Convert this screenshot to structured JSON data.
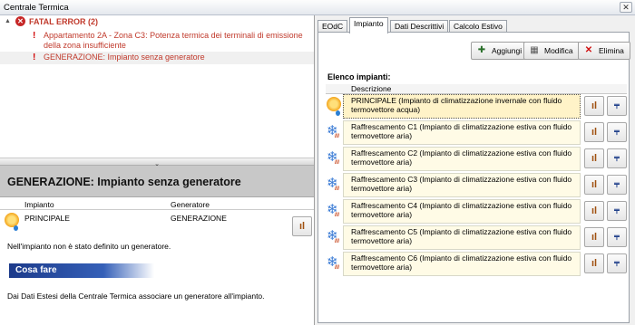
{
  "window": {
    "title": "Centrale Termica",
    "close_label": "✕"
  },
  "tree": {
    "collapse_glyph": "▲",
    "fatal_label": "FATAL ERROR (2)",
    "items": [
      {
        "text": "Appartamento 2A - Zona C3: Potenza termica dei terminali di emissione della zona insufficiente"
      },
      {
        "text": "GENERAZIONE: Impianto senza generatore"
      }
    ],
    "warn_glyph": "!"
  },
  "splitter_glyph": "⌄",
  "detail": {
    "title": "GENERAZIONE: Impianto senza generatore",
    "columns": [
      "Impianto",
      "Generatore"
    ],
    "row": {
      "impianto": "PRINCIPALE",
      "generatore": "GENERAZIONE"
    },
    "message": "Nell'impianto non è stato definito un generatore.",
    "todo_title": "Cosa fare",
    "hint": "Dai Dati Estesi della Centrale Termica associare un generatore all'impianto."
  },
  "tabs": [
    "EOdC",
    "Impianto",
    "Dati Descrittivi",
    "Calcolo Estivo"
  ],
  "active_tab": "Impianto",
  "toolbar": {
    "add_label": "Aggiungi",
    "edit_label": "Modifica",
    "delete_label": "Elimina"
  },
  "list": {
    "title": "Elenco impianti:",
    "column": "Descrizione",
    "rows": [
      {
        "text": "PRINCIPALE (Impianto di climatizzazione invernale con fluido termovettore acqua)",
        "icon": "sun-icon"
      },
      {
        "text": "Raffrescamento C1 (Impianto di climatizzazione estiva con fluido termovettore aria)",
        "icon": "snowflake-icon"
      },
      {
        "text": "Raffrescamento C2 (Impianto di climatizzazione estiva con fluido termovettore aria)",
        "icon": "snowflake-icon"
      },
      {
        "text": "Raffrescamento C3 (Impianto di climatizzazione estiva con fluido termovettore aria)",
        "icon": "snowflake-icon"
      },
      {
        "text": "Raffrescamento C4 (Impianto di climatizzazione estiva con fluido termovettore aria)",
        "icon": "snowflake-icon"
      },
      {
        "text": "Raffrescamento C5 (Impianto di climatizzazione estiva con fluido termovettore aria)",
        "icon": "snowflake-icon"
      },
      {
        "text": "Raffrescamento C6 (Impianto di climatizzazione estiva con fluido termovettore aria)",
        "icon": "snowflake-icon"
      }
    ]
  },
  "colors": {
    "error": "#c0392b",
    "todo_bar": "#1c3a8a",
    "row_bg": "#fffbe6"
  }
}
